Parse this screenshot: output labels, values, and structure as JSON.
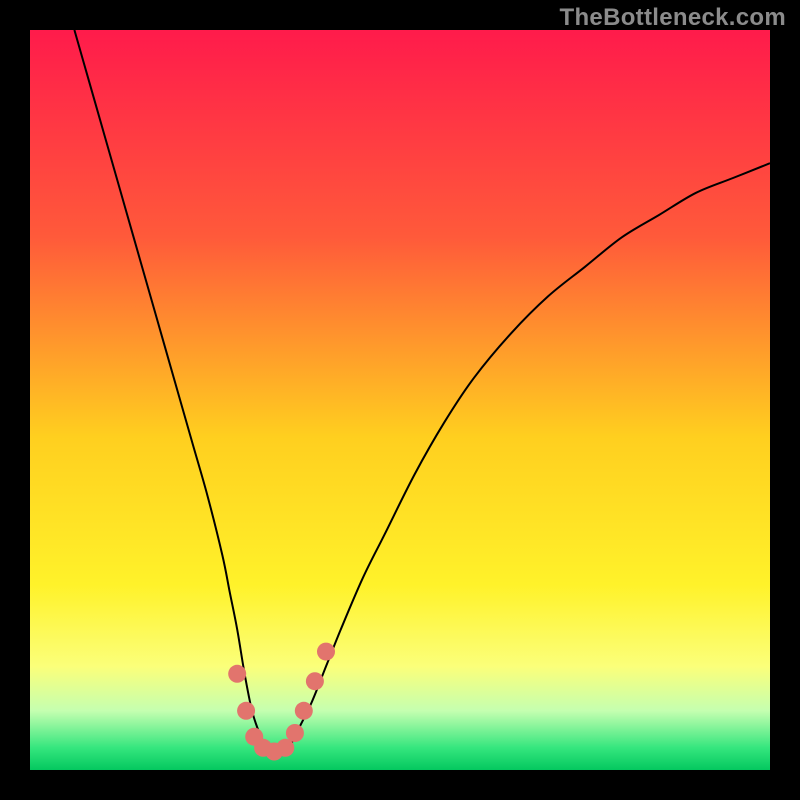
{
  "watermark": "TheBottleneck.com",
  "chart_data": {
    "type": "line",
    "title": "",
    "xlabel": "",
    "ylabel": "",
    "xlim": [
      0,
      100
    ],
    "ylim": [
      0,
      100
    ],
    "background_gradient": {
      "stops": [
        {
          "offset": 0,
          "color": "#ff1b4b"
        },
        {
          "offset": 28,
          "color": "#ff5a3a"
        },
        {
          "offset": 55,
          "color": "#ffcf1f"
        },
        {
          "offset": 75,
          "color": "#fff22a"
        },
        {
          "offset": 86,
          "color": "#fbff7a"
        },
        {
          "offset": 92,
          "color": "#c5ffb0"
        },
        {
          "offset": 97,
          "color": "#35e67e"
        },
        {
          "offset": 100,
          "color": "#04c85f"
        }
      ]
    },
    "series": [
      {
        "name": "bottleneck-curve",
        "color": "#000000",
        "x": [
          6,
          8,
          10,
          12,
          14,
          16,
          18,
          20,
          22,
          24,
          26,
          27,
          28,
          29,
          30,
          31,
          32,
          33,
          34,
          35,
          36,
          38,
          40,
          42,
          45,
          48,
          52,
          56,
          60,
          65,
          70,
          75,
          80,
          85,
          90,
          95,
          100
        ],
        "y": [
          100,
          93,
          86,
          79,
          72,
          65,
          58,
          51,
          44,
          37,
          29,
          24,
          19,
          13,
          8,
          5,
          3,
          2,
          2,
          3,
          5,
          9,
          14,
          19,
          26,
          32,
          40,
          47,
          53,
          59,
          64,
          68,
          72,
          75,
          78,
          80,
          82
        ]
      }
    ],
    "markers": {
      "color": "#e2746d",
      "points": [
        {
          "x": 28.0,
          "y": 13
        },
        {
          "x": 29.2,
          "y": 8
        },
        {
          "x": 30.3,
          "y": 4.5
        },
        {
          "x": 31.5,
          "y": 3
        },
        {
          "x": 33.0,
          "y": 2.5
        },
        {
          "x": 34.5,
          "y": 3
        },
        {
          "x": 35.8,
          "y": 5
        },
        {
          "x": 37.0,
          "y": 8
        },
        {
          "x": 38.5,
          "y": 12
        },
        {
          "x": 40.0,
          "y": 16
        }
      ]
    }
  }
}
